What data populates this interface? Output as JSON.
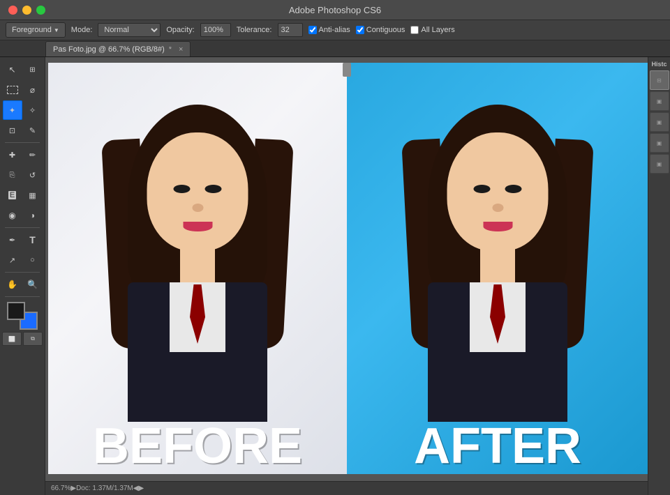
{
  "app": {
    "title": "Adobe Photoshop CS6",
    "window_controls": {
      "close": "●",
      "minimize": "●",
      "maximize": "●"
    }
  },
  "options_bar": {
    "tool_label": "Foreground",
    "mode_label": "Mode:",
    "mode_value": "Normal",
    "opacity_label": "Opacity:",
    "opacity_value": "100%",
    "tolerance_label": "Tolerance:",
    "tolerance_value": "32",
    "anti_alias_label": "Anti-alias",
    "contiguous_label": "Contiguous",
    "all_layers_label": "All Layers"
  },
  "tab": {
    "filename": "Pas Foto.jpg @ 66.7% (RGB/8#)",
    "modified": true,
    "close_btn": "×"
  },
  "canvas": {
    "before_label": "BEFORE",
    "after_label": "AFTER"
  },
  "history_panel": {
    "title": "Histc"
  },
  "status_bar": {
    "zoom": "66.7%",
    "doc_info": "Doc: 1.37M/1.37M"
  },
  "toolbar": {
    "tools": [
      {
        "id": "move",
        "icon": "↖",
        "label": "Move Tool"
      },
      {
        "id": "marquee-rect",
        "icon": "⬜",
        "label": "Rectangular Marquee"
      },
      {
        "id": "lasso",
        "icon": "⌀",
        "label": "Lasso Tool"
      },
      {
        "id": "magic-wand",
        "icon": "✦",
        "label": "Magic Wand"
      },
      {
        "id": "crop",
        "icon": "⊡",
        "label": "Crop Tool"
      },
      {
        "id": "eyedropper",
        "icon": "🔬",
        "label": "Eyedropper"
      },
      {
        "id": "heal",
        "icon": "✚",
        "label": "Healing Brush"
      },
      {
        "id": "brush",
        "icon": "✏",
        "label": "Brush Tool"
      },
      {
        "id": "clone",
        "icon": "⎘",
        "label": "Clone Stamp"
      },
      {
        "id": "eraser",
        "icon": "◻",
        "label": "Eraser"
      },
      {
        "id": "gradient",
        "icon": "▦",
        "label": "Gradient Tool"
      },
      {
        "id": "blur",
        "icon": "◉",
        "label": "Blur Tool"
      },
      {
        "id": "dodge",
        "icon": "◑",
        "label": "Dodge Tool"
      },
      {
        "id": "pen",
        "icon": "✒",
        "label": "Pen Tool"
      },
      {
        "id": "text",
        "icon": "T",
        "label": "Text Tool"
      },
      {
        "id": "path-select",
        "icon": "↗",
        "label": "Path Selection"
      },
      {
        "id": "shape",
        "icon": "○",
        "label": "Shape Tool"
      },
      {
        "id": "hand",
        "icon": "✋",
        "label": "Hand Tool"
      },
      {
        "id": "zoom",
        "icon": "🔍",
        "label": "Zoom Tool"
      }
    ]
  },
  "colors": {
    "app_bg": "#3a3a3a",
    "toolbar_bg": "#404040",
    "tab_bg": "#525252",
    "accent_blue": "#1a7aff",
    "before_bg": "#e8eaf2",
    "after_bg": "#29a8e0",
    "hair_dark": "#251208",
    "skin": "#f0c8a0",
    "lip_red": "#cc3355",
    "suit_dark": "#1a1a28",
    "tie_red": "#8B0000"
  }
}
